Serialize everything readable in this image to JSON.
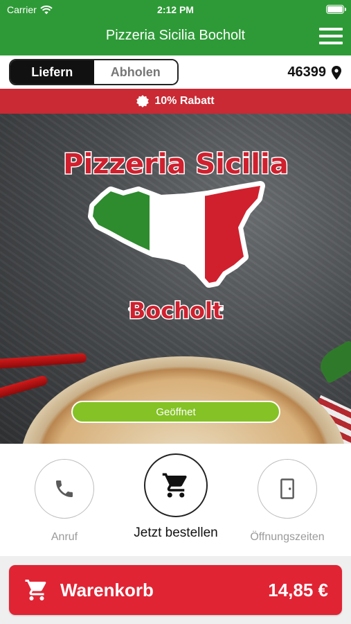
{
  "status_bar": {
    "carrier": "Carrier",
    "time": "2:12 PM"
  },
  "nav": {
    "title": "Pizzeria Sicilia Bocholt",
    "menu_icon": "hamburger-menu-icon"
  },
  "delivery": {
    "options": [
      "Liefern",
      "Abholen"
    ],
    "selected": "Liefern",
    "zip": "46399",
    "zip_icon": "location-pin-icon"
  },
  "discount": {
    "label": "10% Rabatt",
    "icon": "badge-icon"
  },
  "hero": {
    "logo_title": "Pizzeria Sicilia",
    "logo_subtitle": "Bocholt",
    "logo_dot": "•",
    "status": "Geöffnet"
  },
  "actions": {
    "call": {
      "label": "Anruf",
      "icon": "phone-icon"
    },
    "order": {
      "label": "Jetzt bestellen",
      "icon": "cart-icon"
    },
    "hours": {
      "label": "Öffnungszeiten",
      "icon": "door-icon"
    }
  },
  "cart": {
    "label": "Warenkorb",
    "total": "14,85 €",
    "icon": "cart-icon"
  },
  "colors": {
    "nav_green": "#2e9a37",
    "discount_red": "#c92a34",
    "cart_red": "#e02434",
    "open_green": "#84c225",
    "flag_green": "#2e8b2e",
    "flag_red": "#d0202e"
  }
}
